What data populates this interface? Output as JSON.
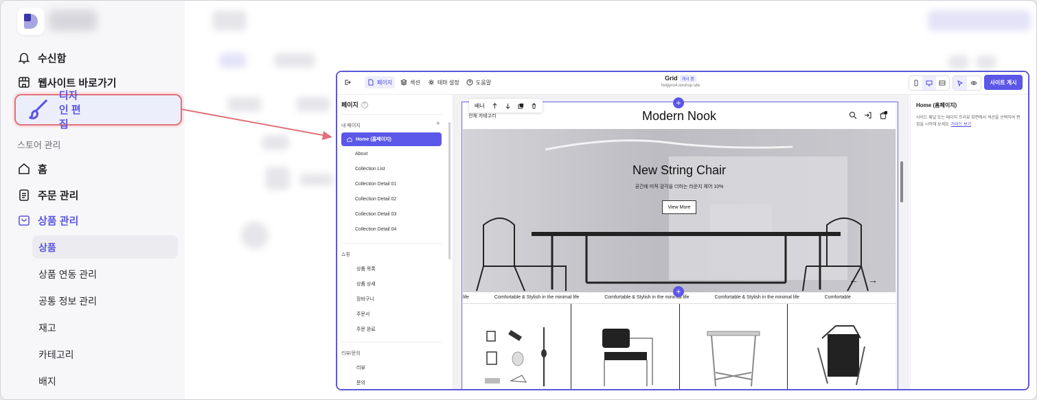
{
  "sidebar": {
    "inbox": "수신함",
    "website": "웹사이트 바로가기",
    "design_edit": "디자인 편집",
    "section_store": "스토어 관리",
    "home": "홈",
    "orders": "주문 관리",
    "products": "상품 관리",
    "sub": [
      "상품",
      "상품 연동 관리",
      "공통 정보 관리",
      "재고",
      "카테고리",
      "배지"
    ]
  },
  "editor": {
    "topbar": {
      "pages_tab": "페이지",
      "section_tab": "섹션",
      "theme_tab": "테마 설정",
      "help_tab": "도움말",
      "site_name": "Grid",
      "status_badge": "게시 중",
      "url": "helppro4.sixshop.site",
      "publish_label": "사이트 게시"
    },
    "pages_panel": {
      "title": "페이지",
      "my_pages_label": "내 페이지",
      "active_page": "Home (홈페이지)",
      "my_pages": [
        "About",
        "Collection List",
        "Collection Detail 01",
        "Collection Detail 02",
        "Collection Detail 03",
        "Collection Detail 04"
      ],
      "shop_label": "쇼핑",
      "shop_pages": [
        "상품 목록",
        "상품 상세",
        "장바구니",
        "주문서",
        "주문 완료"
      ],
      "review_label": "리뷰/문의",
      "review_pages": [
        "리뷰",
        "문의"
      ]
    },
    "canvas": {
      "section_toolbar_label": "배너",
      "category_text": "전체 카테고리",
      "logo": "Modern Nook",
      "cart_count": "2",
      "hero_title": "New String Chair",
      "hero_subtitle": "공간에 미적 감각을 더하는 라운지 체어 10%",
      "hero_button": "View More",
      "marquee_items": [
        "life",
        "Comfortable & Stylish in the minimal life",
        "Comfortable & Stylish in the minimal life",
        "Comfortable & Stylish in the minimal life",
        "Comfortable"
      ]
    },
    "inspector": {
      "title": "Home (홈페이지)",
      "description": "사이드 패널 또는 페이지 프리뷰 화면에서 섹션을 선택하여 편집을 시작해 보세요.",
      "link_text": "가이드 보기"
    }
  },
  "colors": {
    "accent": "#5b57e8",
    "highlight_border": "#e07079",
    "active_nav": "#5a55e0"
  }
}
